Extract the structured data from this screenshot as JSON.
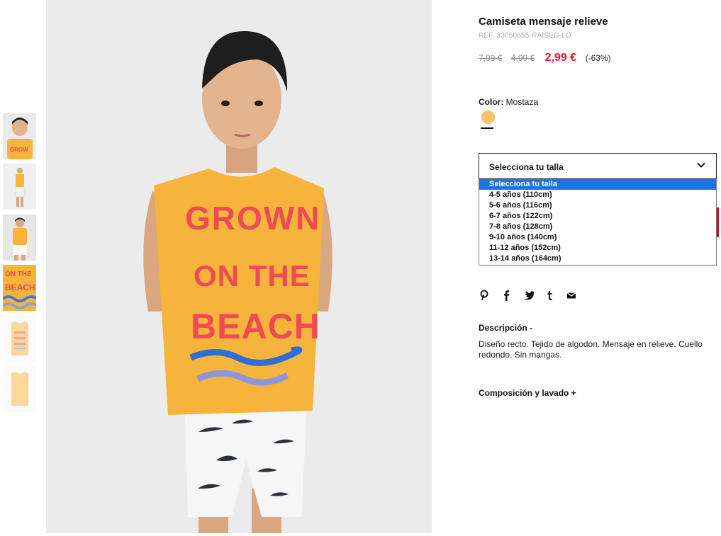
{
  "product": {
    "title": "Camiseta mensaje relieve",
    "ref": "REF. 33050655-RAISED-LO",
    "prices": {
      "original": "7,99 €",
      "previous": "4,99 €",
      "current": "2,99 €",
      "discount": "(-63%)"
    },
    "color": {
      "label": "Color:",
      "value": "Mostaza",
      "swatch": "#f5c46a"
    },
    "shirt_print": {
      "line1": "GROWN",
      "line2": "ON THE",
      "line3": "BEACH"
    },
    "thumb_print": {
      "line1": "ON THE",
      "line2": "BEACH"
    }
  },
  "size_select": {
    "selected": "Selecciona tu talla",
    "options": [
      "Selecciona tu talla",
      "4-5 años (110cm)",
      "5-6 años (116cm)",
      "6-7 años (122cm)",
      "7-8 años (128cm)",
      "9-10 años (140cm)",
      "11-12 años (152cm)",
      "13-14 años (164cm)"
    ]
  },
  "share": {
    "icons": [
      "pinterest-icon",
      "facebook-icon",
      "twitter-icon",
      "tumblr-icon",
      "mail-icon"
    ]
  },
  "description": {
    "title": "Descripción",
    "toggle": "-",
    "text": "Diseño recto. Tejido de algodón. Mensaje en relieve. Cuello redondo. Sin mangas."
  },
  "composition": {
    "title": "Composición y lavado",
    "toggle": "+"
  },
  "colors": {
    "accent": "#e1132b",
    "select_highlight": "#1e73e8",
    "shirt": "#f7b43c",
    "print": "#ee4b52"
  }
}
